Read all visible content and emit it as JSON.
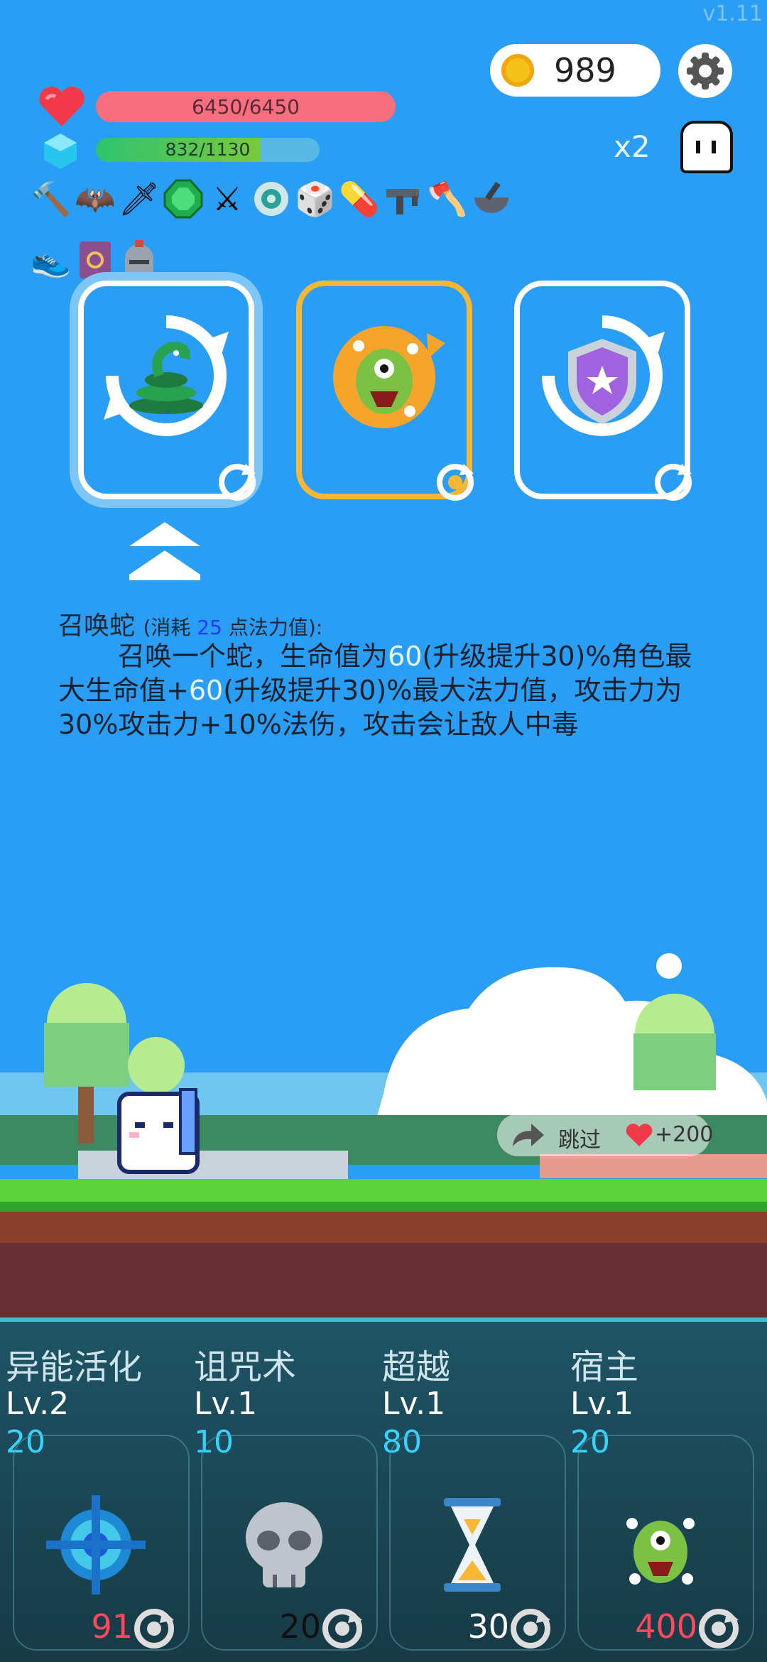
{
  "version": "v1.11",
  "coins": "989",
  "hp": "6450/6450",
  "mp": "832/1130",
  "mp_fraction": 0.736,
  "multiplier": "x2",
  "items_row1": [
    "hammer-icon",
    "bat-icon",
    "dagger-icon",
    "emerald-icon",
    "sword-icon",
    "ring-icon",
    "dice-icon",
    "pill-icon",
    "uzi-icon",
    "axe-icon",
    "mortar-icon"
  ],
  "items_row2": [
    "sneaker-icon",
    "spellbook-icon",
    "helmet-icon"
  ],
  "cards": [
    {
      "name": "summon-snake-card",
      "selected": true
    },
    {
      "name": "monster-card",
      "selected": false
    },
    {
      "name": "shield-card",
      "selected": false
    }
  ],
  "desc": {
    "title": "召唤蛇",
    "cost_prefix": "(消耗 ",
    "cost": "25",
    "cost_suffix": " 点法力值):",
    "p1": "召唤一个蛇，生命值为",
    "v1": "60",
    "p2": "(升级提升30)%角色最大生命值+",
    "v2": "60",
    "p3": "(升级提升30)%最大法力值，攻击力为30%攻击力+10%法伤，攻击会让敌人中毒"
  },
  "skip": {
    "label": "跳过",
    "reward": "+200"
  },
  "skills": [
    {
      "name": "异能活化",
      "level": "Lv.2",
      "cost": "20",
      "price": "91",
      "price_color": "#ff4a5e"
    },
    {
      "name": "诅咒术",
      "level": "Lv.1",
      "cost": "10",
      "price": "20",
      "price_color": "#111111"
    },
    {
      "name": "超越",
      "level": "Lv.1",
      "cost": "80",
      "price": "30",
      "price_color": "#ffffff"
    },
    {
      "name": "宿主",
      "level": "Lv.1",
      "cost": "20",
      "price": "400",
      "price_color": "#ff4a5e"
    }
  ]
}
